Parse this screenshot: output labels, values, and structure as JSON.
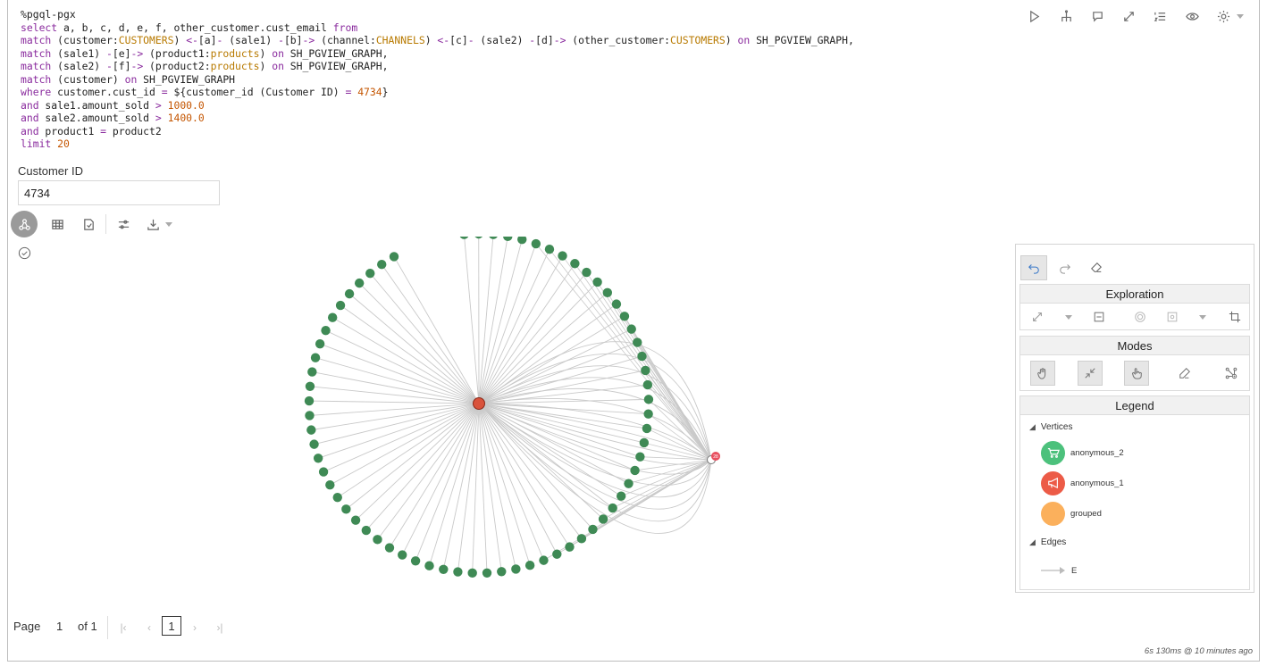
{
  "editor": {
    "lines": [
      [
        {
          "t": "%pgql-pgx",
          "c": "p"
        }
      ],
      [
        {
          "t": "select",
          "c": "k"
        },
        {
          "t": " a, b, c, d, e, f, other_customer.cust_email ",
          "c": "p"
        },
        {
          "t": "from",
          "c": "k"
        }
      ],
      [
        {
          "t": "match",
          "c": "k"
        },
        {
          "t": " (customer:",
          "c": "p"
        },
        {
          "t": "CUSTOMERS",
          "c": "l"
        },
        {
          "t": ") ",
          "c": "p"
        },
        {
          "t": "<-",
          "c": "o"
        },
        {
          "t": "[a]",
          "c": "p"
        },
        {
          "t": "-",
          "c": "o"
        },
        {
          "t": " (sale1) ",
          "c": "p"
        },
        {
          "t": "-",
          "c": "o"
        },
        {
          "t": "[b]",
          "c": "p"
        },
        {
          "t": "->",
          "c": "o"
        },
        {
          "t": " (channel:",
          "c": "p"
        },
        {
          "t": "CHANNELS",
          "c": "l"
        },
        {
          "t": ") ",
          "c": "p"
        },
        {
          "t": "<-",
          "c": "o"
        },
        {
          "t": "[c]",
          "c": "p"
        },
        {
          "t": "-",
          "c": "o"
        },
        {
          "t": " (sale2) ",
          "c": "p"
        },
        {
          "t": "-",
          "c": "o"
        },
        {
          "t": "[d]",
          "c": "p"
        },
        {
          "t": "->",
          "c": "o"
        },
        {
          "t": " (other_customer:",
          "c": "p"
        },
        {
          "t": "CUSTOMERS",
          "c": "l"
        },
        {
          "t": ") ",
          "c": "p"
        },
        {
          "t": "on",
          "c": "k"
        },
        {
          "t": " SH_PGVIEW_GRAPH,",
          "c": "p"
        }
      ],
      [
        {
          "t": "match",
          "c": "k"
        },
        {
          "t": " (sale1) ",
          "c": "p"
        },
        {
          "t": "-",
          "c": "o"
        },
        {
          "t": "[e]",
          "c": "p"
        },
        {
          "t": "->",
          "c": "o"
        },
        {
          "t": " (product1:",
          "c": "p"
        },
        {
          "t": "products",
          "c": "l"
        },
        {
          "t": ") ",
          "c": "p"
        },
        {
          "t": "on",
          "c": "k"
        },
        {
          "t": " SH_PGVIEW_GRAPH,",
          "c": "p"
        }
      ],
      [
        {
          "t": "match",
          "c": "k"
        },
        {
          "t": " (sale2) ",
          "c": "p"
        },
        {
          "t": "-",
          "c": "o"
        },
        {
          "t": "[f]",
          "c": "p"
        },
        {
          "t": "->",
          "c": "o"
        },
        {
          "t": " (product2:",
          "c": "p"
        },
        {
          "t": "products",
          "c": "l"
        },
        {
          "t": ") ",
          "c": "p"
        },
        {
          "t": "on",
          "c": "k"
        },
        {
          "t": " SH_PGVIEW_GRAPH,",
          "c": "p"
        }
      ],
      [
        {
          "t": "match",
          "c": "k"
        },
        {
          "t": " (customer) ",
          "c": "p"
        },
        {
          "t": "on",
          "c": "k"
        },
        {
          "t": " SH_PGVIEW_GRAPH",
          "c": "p"
        }
      ],
      [
        {
          "t": "where",
          "c": "k"
        },
        {
          "t": " customer.cust_id ",
          "c": "p"
        },
        {
          "t": "=",
          "c": "o"
        },
        {
          "t": " ${customer_id (Customer ID) ",
          "c": "p"
        },
        {
          "t": "=",
          "c": "o"
        },
        {
          "t": " ",
          "c": "p"
        },
        {
          "t": "4734",
          "c": "n"
        },
        {
          "t": "}",
          "c": "p"
        }
      ],
      [
        {
          "t": "and",
          "c": "k"
        },
        {
          "t": " sale1.amount_sold ",
          "c": "p"
        },
        {
          "t": ">",
          "c": "o"
        },
        {
          "t": " ",
          "c": "p"
        },
        {
          "t": "1000.0",
          "c": "n"
        }
      ],
      [
        {
          "t": "and",
          "c": "k"
        },
        {
          "t": " sale2.amount_sold ",
          "c": "p"
        },
        {
          "t": ">",
          "c": "o"
        },
        {
          "t": " ",
          "c": "p"
        },
        {
          "t": "1400.0",
          "c": "n"
        }
      ],
      [
        {
          "t": "and",
          "c": "k"
        },
        {
          "t": " product1 ",
          "c": "p"
        },
        {
          "t": "=",
          "c": "o"
        },
        {
          "t": " product2",
          "c": "p"
        }
      ],
      [
        {
          "t": "limit",
          "c": "k"
        },
        {
          "t": " ",
          "c": "p"
        },
        {
          "t": "20",
          "c": "n"
        }
      ]
    ]
  },
  "toolbar": {
    "icons": [
      "run-icon",
      "hierarchy-icon",
      "comment-icon",
      "expand-icon",
      "numbered-list-icon",
      "eye-icon",
      "gear-icon"
    ]
  },
  "params": {
    "label": "Customer ID",
    "value": "4734"
  },
  "view_toolbar": {
    "icons": [
      "graph-view-icon",
      "table-icon",
      "export-pdf-icon",
      "settings-sliders-icon",
      "download-icon"
    ]
  },
  "graph": {
    "node_count": 69,
    "edge_color": "#c9c9c9",
    "node_color": "#3f8a55",
    "center_color": "#d9533c",
    "right_color": "#e84f5f",
    "right_badge": "28"
  },
  "panel": {
    "exploration": "Exploration",
    "modes": "Modes",
    "legend": "Legend",
    "vertices_label": "Vertices",
    "edges_label": "Edges",
    "legend_items": [
      {
        "label": "anonymous_2",
        "color": "#4cc17c",
        "icon": "cart-icon"
      },
      {
        "label": "anonymous_1",
        "color": "#ec5b47",
        "icon": "megaphone-icon"
      },
      {
        "label": "grouped",
        "color": "#fbb05c",
        "icon": ""
      }
    ],
    "edge_item": "E"
  },
  "pager": {
    "page_label": "Page",
    "page_value": "1",
    "of_label": "of 1",
    "current": "1"
  },
  "status": "6s 130ms @ 10 minutes ago"
}
